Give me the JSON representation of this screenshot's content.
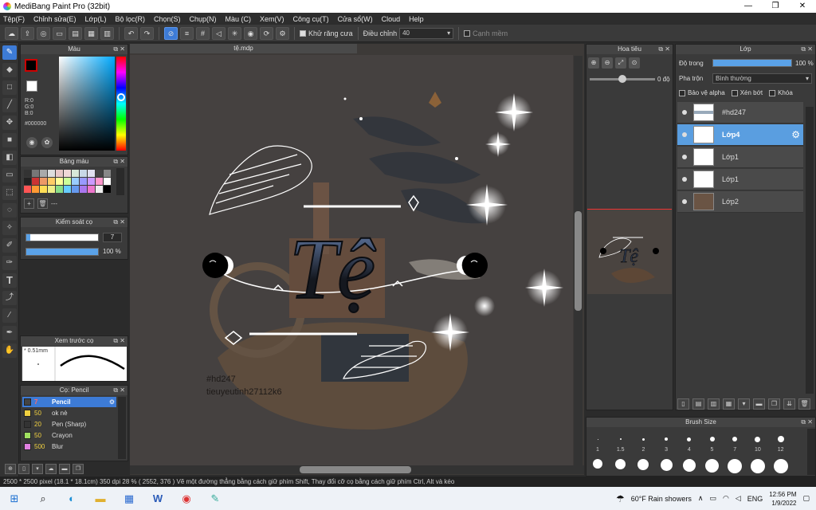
{
  "window": {
    "title": "MediBang Paint Pro (32bit)",
    "btn_min": "—",
    "btn_max": "❐",
    "btn_close": "✕"
  },
  "menu": [
    "Tệp(F)",
    "Chỉnh sửa(E)",
    "Lớp(L)",
    "Bộ lọc(R)",
    "Chọn(S)",
    "Chụp(N)",
    "Màu (C)",
    "Xem(V)",
    "Công cụ(T)",
    "Cửa sổ(W)",
    "Cloud",
    "Help"
  ],
  "toolbar": {
    "antialias_label": "Khử răng cưa",
    "adjust_label": "Điều chỉnh",
    "adjust_value": "40",
    "edge_label": "Cạnh mềm"
  },
  "color_panel": {
    "title": "Màu",
    "r": "R:0",
    "g": "G:0",
    "b": "B:0",
    "hex": "#000000",
    "fg": "#000000"
  },
  "palette_panel": {
    "title": "Bảng màu",
    "dash": "---"
  },
  "brush_control": {
    "title": "Kiểm soát cọ",
    "size": "7",
    "opacity": "100 %",
    "size_fraction": 0.05,
    "opacity_fraction": 1.0
  },
  "brush_preview": {
    "title": "Xem trước cọ",
    "size_label": "* 0.51mm"
  },
  "brush_list": {
    "title": "Cọ: Pencil",
    "items": [
      {
        "size": "7",
        "name": "Pencil",
        "color": "#444444"
      },
      {
        "size": "50",
        "name": "ok nè",
        "color": "#f0d040"
      },
      {
        "size": "20",
        "name": "Pen (Sharp)",
        "color": "#333333"
      },
      {
        "size": "50",
        "name": "Crayon",
        "color": "#a0e060"
      },
      {
        "size": "500",
        "name": "Blur",
        "color": "#e080e0"
      }
    ]
  },
  "canvas": {
    "tab": "tệ.mdp",
    "title_text": "Tệ",
    "sig1": "#hd247",
    "sig2": "tieuyeutinh27112k6"
  },
  "navigator": {
    "title": "Hoa tiêu",
    "angle": "0 độ"
  },
  "layers": {
    "title": "Lớp",
    "opacity_label": "Độ trong",
    "opacity_value": "100 %",
    "blend_label": "Pha trộn",
    "blend_value": "Bình thường",
    "check_alpha": "Bảo vệ alpha",
    "check_clip": "Xén bớt",
    "check_lock": "Khóa",
    "items": [
      {
        "name": "#hd247"
      },
      {
        "name": "Lớp4"
      },
      {
        "name": "Lớp1"
      },
      {
        "name": "Lớp1"
      },
      {
        "name": "Lớp2"
      }
    ]
  },
  "brush_size": {
    "title": "Brush Size",
    "row1": [
      "1",
      "1.5",
      "2",
      "3",
      "4",
      "5",
      "7",
      "10",
      "12"
    ]
  },
  "status": "2500 * 2500 pixel   (18.1 * 18.1cm)  350 dpi   28 %   ( 2552, 376 )   Vẽ một đường thẳng bằng cách giữ phím Shift, Thay đổi cỡ cọ bằng cách giữ phím Ctrl, Alt và kéo",
  "taskbar": {
    "weather": "60°F  Rain showers",
    "lang": "ENG",
    "time": "12:56 PM",
    "date": "1/9/2022"
  }
}
